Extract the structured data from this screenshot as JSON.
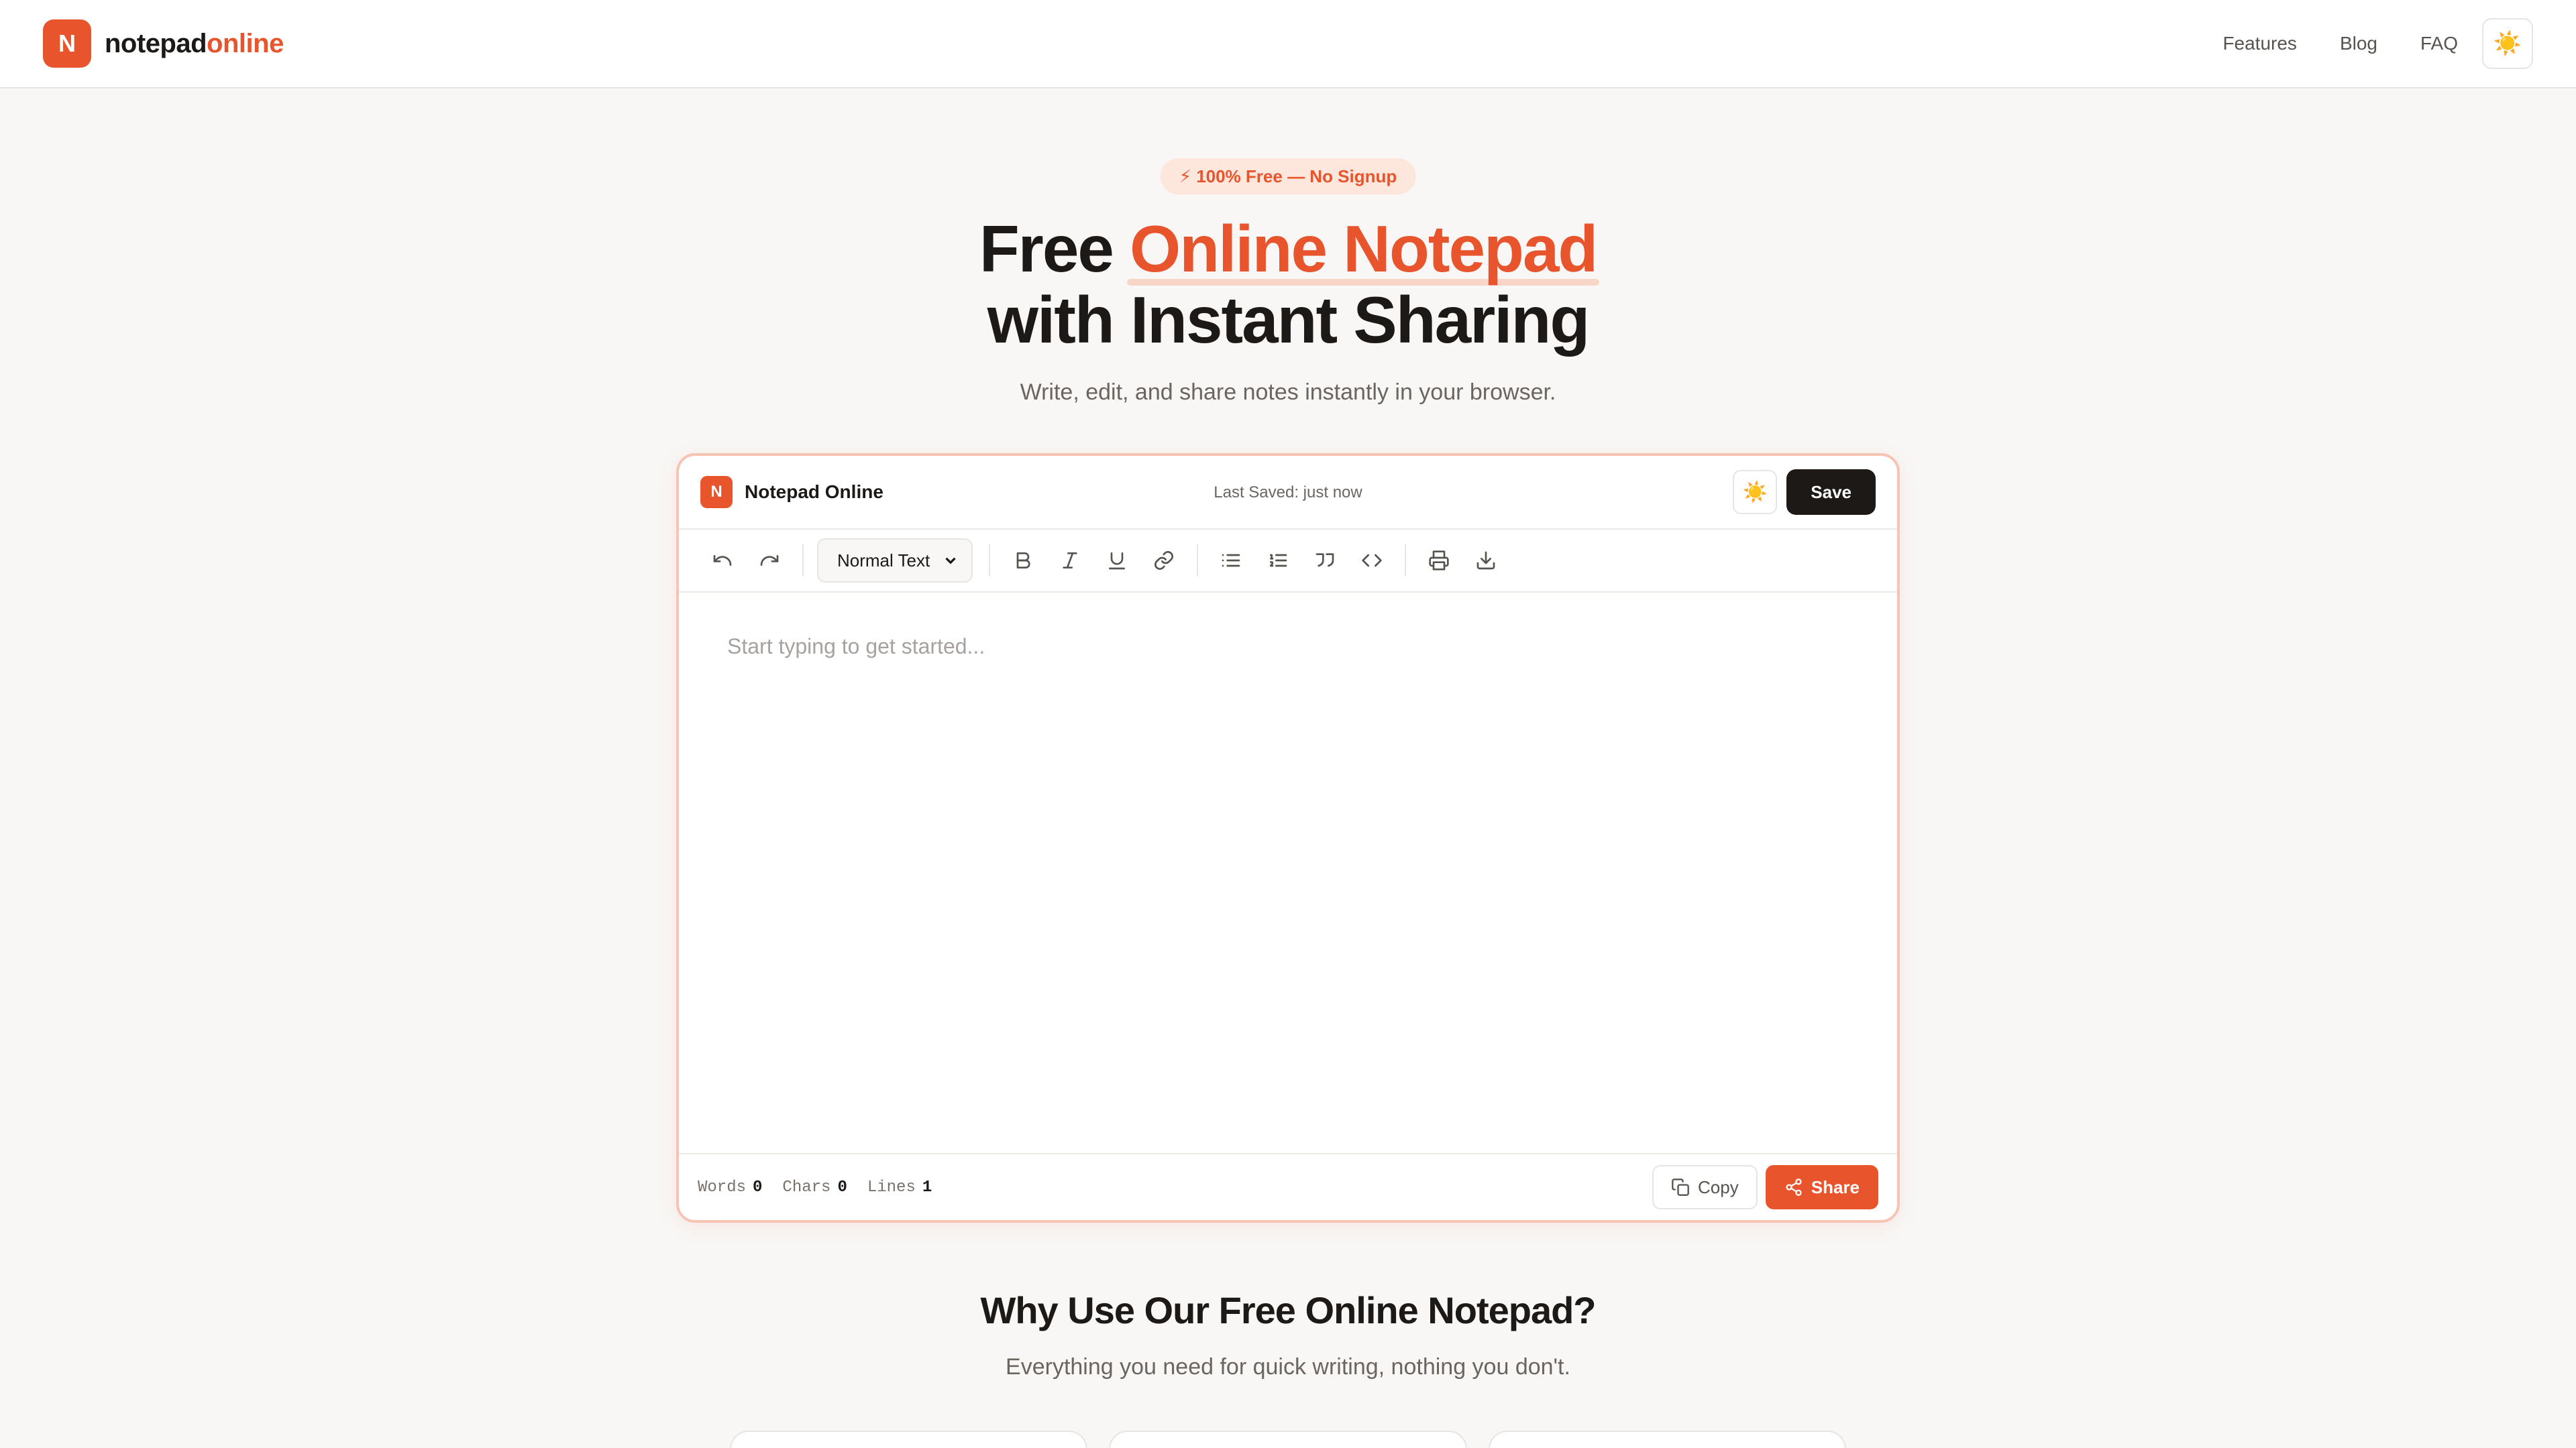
{
  "nav": {
    "logo_letter": "N",
    "brand_main": "notepad",
    "brand_accent": "online",
    "links": [
      "Features",
      "Blog",
      "FAQ"
    ],
    "theme_icon": "☀️"
  },
  "hero": {
    "badge": "⚡ 100% Free — No Signup",
    "title_pre": "Free ",
    "title_highlight": "Online Notepad",
    "title_line2": "with Instant Sharing",
    "subtitle": "Write, edit, and share notes instantly in your browser."
  },
  "editor": {
    "logo_letter": "N",
    "name": "Notepad Online",
    "last_saved": "Last Saved: just now",
    "theme_icon": "☀️",
    "save_label": "Save",
    "format_select": "Normal Text",
    "placeholder": "Start typing to get started...",
    "stats": {
      "words_label": "Words",
      "words_value": "0",
      "chars_label": "Chars",
      "chars_value": "0",
      "lines_label": "Lines",
      "lines_value": "1"
    },
    "copy_label": "Copy",
    "share_label": "Share"
  },
  "why": {
    "title": "Why Use Our Free Online Notepad?",
    "subtitle": "Everything you need for quick writing, nothing you don't."
  },
  "colors": {
    "accent": "#e8552d",
    "dark": "#1c1917",
    "background": "#f8f7f6"
  }
}
